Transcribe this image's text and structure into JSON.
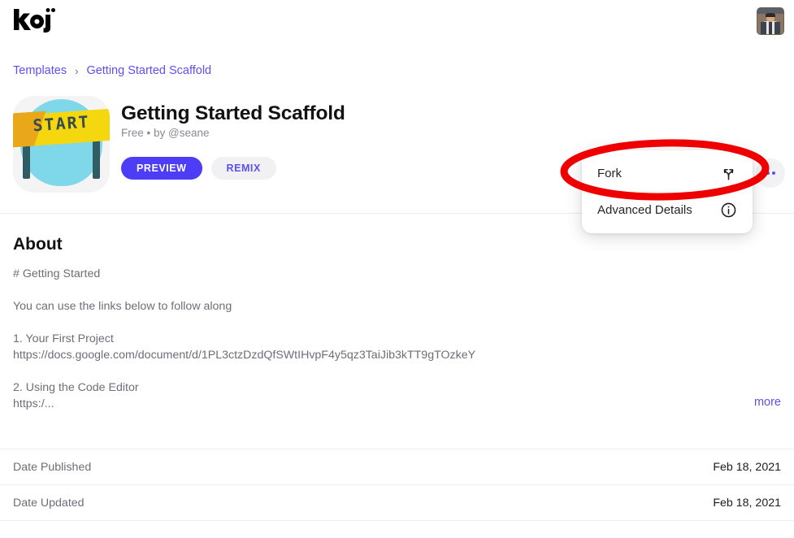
{
  "brand": {
    "name": "koji"
  },
  "topbar": {
    "avatar_name": "user-avatar"
  },
  "breadcrumb": {
    "items": [
      {
        "label": "Templates"
      },
      {
        "label": "Getting Started Scaffold"
      }
    ],
    "separator": "›"
  },
  "app": {
    "icon_text": "START",
    "title": "Getting Started Scaffold",
    "subtitle": "Free • by @seane",
    "buttons": [
      {
        "label": "PREVIEW",
        "style": "primary"
      },
      {
        "label": "REMIX",
        "style": "ghost"
      }
    ],
    "more_button_label": "•••"
  },
  "about": {
    "heading": "About",
    "body": "# Getting Started\n\nYou can use the links below to follow along\n\n1. Your First Project\nhttps://docs.google.com/document/d/1PL3ctzDzdQfSWtIHvpF4y5qz3TaiJib3kTT9gTOzkeY\n\n2. Using the Code Editor\nhttps:/...",
    "more_label": "more"
  },
  "meta_rows": [
    {
      "key": "Date Published",
      "value": "Feb 18, 2021"
    },
    {
      "key": "Date Updated",
      "value": "Feb 18, 2021"
    }
  ],
  "menu": {
    "items": [
      {
        "label": "Fork",
        "icon": "fork-icon"
      },
      {
        "label": "Advanced Details",
        "icon": "info-icon"
      }
    ]
  },
  "annotation": {
    "shape": "ellipse",
    "color": "#ee0000",
    "target": "Fork"
  },
  "colors": {
    "accent": "#4d3df7",
    "link": "#5d50f0",
    "muted_text": "#6e6e76",
    "annotation_red": "#ee0000"
  }
}
